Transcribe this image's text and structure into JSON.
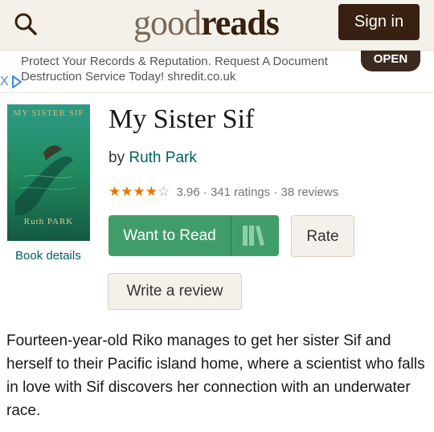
{
  "header": {
    "logo_light": "good",
    "logo_bold": "reads",
    "signin_label": "Sign in"
  },
  "ad": {
    "text": "Protect Your Records & Reputation. Request A Document Destruction Service Today! shredit.co.uk",
    "open_label": "OPEN",
    "close_glyph": "X"
  },
  "book": {
    "cover_title": "MY SISTER SIF",
    "cover_author": "Ruth PARK",
    "title": "My Sister Sif",
    "by_prefix": "by ",
    "author": "Ruth Park",
    "stars_full": "★★★★",
    "stars_empty": "☆",
    "average_rating": "3.96",
    "ratings": "341 ratings",
    "reviews": "38 reviews",
    "separator": " · ",
    "details_link": "Book details",
    "description": "Fourteen-year-old Riko manages to get her sister Sif and herself to their Pacific island home, where a scientist who falls in love with Sif discovers her connection with an underwater race."
  },
  "actions": {
    "want_to_read": "Want to Read",
    "rate": "Rate",
    "write_review": "Write a review"
  },
  "colors": {
    "header_bg": "#f4f1ea",
    "brand_dark": "#382110",
    "green": "#409d69",
    "link_teal": "#00635d",
    "star_orange": "#e87400"
  },
  "icons": [
    "search-icon",
    "shelf-icon",
    "ad-close-icon",
    "ad-choices-icon"
  ]
}
